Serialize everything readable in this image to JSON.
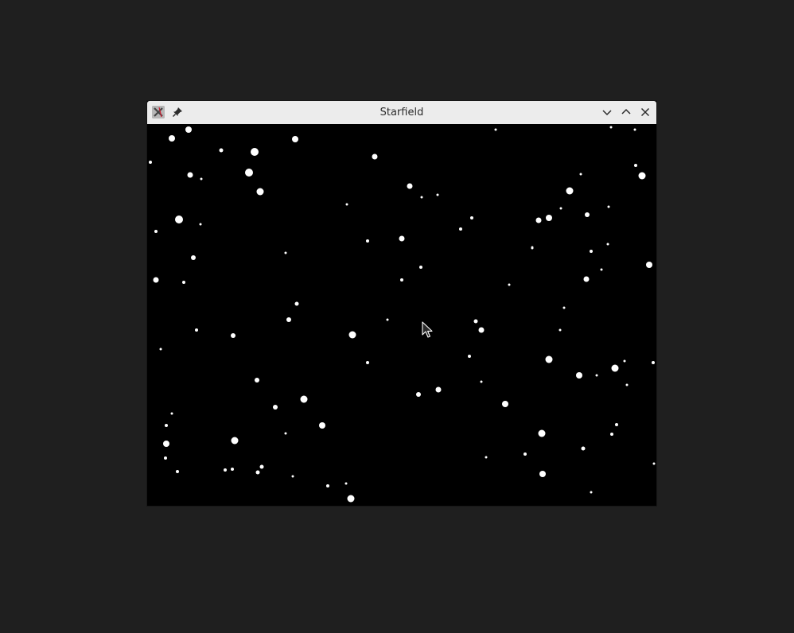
{
  "window": {
    "title": "Starfield"
  },
  "icons": {
    "app": "x-app-icon",
    "pin": "pin-icon",
    "minimize": "chevron-down-icon",
    "maximize": "chevron-up-icon",
    "close": "close-icon"
  },
  "colors": {
    "desktop": "#1f1f1f",
    "titlebar": "#ececec",
    "title_text": "#2b2b2b",
    "canvas": "#000000",
    "star": "#ffffff"
  }
}
